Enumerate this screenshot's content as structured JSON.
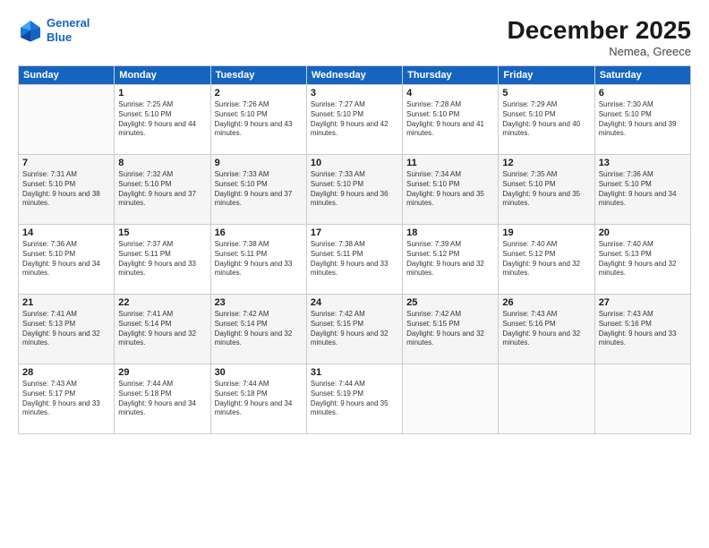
{
  "logo": {
    "line1": "General",
    "line2": "Blue"
  },
  "title": "December 2025",
  "location": "Nemea, Greece",
  "days_header": [
    "Sunday",
    "Monday",
    "Tuesday",
    "Wednesday",
    "Thursday",
    "Friday",
    "Saturday"
  ],
  "weeks": [
    [
      {
        "day": "",
        "sunrise": "",
        "sunset": "",
        "daylight": ""
      },
      {
        "day": "1",
        "sunrise": "Sunrise: 7:25 AM",
        "sunset": "Sunset: 5:10 PM",
        "daylight": "Daylight: 9 hours and 44 minutes."
      },
      {
        "day": "2",
        "sunrise": "Sunrise: 7:26 AM",
        "sunset": "Sunset: 5:10 PM",
        "daylight": "Daylight: 9 hours and 43 minutes."
      },
      {
        "day": "3",
        "sunrise": "Sunrise: 7:27 AM",
        "sunset": "Sunset: 5:10 PM",
        "daylight": "Daylight: 9 hours and 42 minutes."
      },
      {
        "day": "4",
        "sunrise": "Sunrise: 7:28 AM",
        "sunset": "Sunset: 5:10 PM",
        "daylight": "Daylight: 9 hours and 41 minutes."
      },
      {
        "day": "5",
        "sunrise": "Sunrise: 7:29 AM",
        "sunset": "Sunset: 5:10 PM",
        "daylight": "Daylight: 9 hours and 40 minutes."
      },
      {
        "day": "6",
        "sunrise": "Sunrise: 7:30 AM",
        "sunset": "Sunset: 5:10 PM",
        "daylight": "Daylight: 9 hours and 39 minutes."
      }
    ],
    [
      {
        "day": "7",
        "sunrise": "Sunrise: 7:31 AM",
        "sunset": "Sunset: 5:10 PM",
        "daylight": "Daylight: 9 hours and 38 minutes."
      },
      {
        "day": "8",
        "sunrise": "Sunrise: 7:32 AM",
        "sunset": "Sunset: 5:10 PM",
        "daylight": "Daylight: 9 hours and 37 minutes."
      },
      {
        "day": "9",
        "sunrise": "Sunrise: 7:33 AM",
        "sunset": "Sunset: 5:10 PM",
        "daylight": "Daylight: 9 hours and 37 minutes."
      },
      {
        "day": "10",
        "sunrise": "Sunrise: 7:33 AM",
        "sunset": "Sunset: 5:10 PM",
        "daylight": "Daylight: 9 hours and 36 minutes."
      },
      {
        "day": "11",
        "sunrise": "Sunrise: 7:34 AM",
        "sunset": "Sunset: 5:10 PM",
        "daylight": "Daylight: 9 hours and 35 minutes."
      },
      {
        "day": "12",
        "sunrise": "Sunrise: 7:35 AM",
        "sunset": "Sunset: 5:10 PM",
        "daylight": "Daylight: 9 hours and 35 minutes."
      },
      {
        "day": "13",
        "sunrise": "Sunrise: 7:36 AM",
        "sunset": "Sunset: 5:10 PM",
        "daylight": "Daylight: 9 hours and 34 minutes."
      }
    ],
    [
      {
        "day": "14",
        "sunrise": "Sunrise: 7:36 AM",
        "sunset": "Sunset: 5:10 PM",
        "daylight": "Daylight: 9 hours and 34 minutes."
      },
      {
        "day": "15",
        "sunrise": "Sunrise: 7:37 AM",
        "sunset": "Sunset: 5:11 PM",
        "daylight": "Daylight: 9 hours and 33 minutes."
      },
      {
        "day": "16",
        "sunrise": "Sunrise: 7:38 AM",
        "sunset": "Sunset: 5:11 PM",
        "daylight": "Daylight: 9 hours and 33 minutes."
      },
      {
        "day": "17",
        "sunrise": "Sunrise: 7:38 AM",
        "sunset": "Sunset: 5:11 PM",
        "daylight": "Daylight: 9 hours and 33 minutes."
      },
      {
        "day": "18",
        "sunrise": "Sunrise: 7:39 AM",
        "sunset": "Sunset: 5:12 PM",
        "daylight": "Daylight: 9 hours and 32 minutes."
      },
      {
        "day": "19",
        "sunrise": "Sunrise: 7:40 AM",
        "sunset": "Sunset: 5:12 PM",
        "daylight": "Daylight: 9 hours and 32 minutes."
      },
      {
        "day": "20",
        "sunrise": "Sunrise: 7:40 AM",
        "sunset": "Sunset: 5:13 PM",
        "daylight": "Daylight: 9 hours and 32 minutes."
      }
    ],
    [
      {
        "day": "21",
        "sunrise": "Sunrise: 7:41 AM",
        "sunset": "Sunset: 5:13 PM",
        "daylight": "Daylight: 9 hours and 32 minutes."
      },
      {
        "day": "22",
        "sunrise": "Sunrise: 7:41 AM",
        "sunset": "Sunset: 5:14 PM",
        "daylight": "Daylight: 9 hours and 32 minutes."
      },
      {
        "day": "23",
        "sunrise": "Sunrise: 7:42 AM",
        "sunset": "Sunset: 5:14 PM",
        "daylight": "Daylight: 9 hours and 32 minutes."
      },
      {
        "day": "24",
        "sunrise": "Sunrise: 7:42 AM",
        "sunset": "Sunset: 5:15 PM",
        "daylight": "Daylight: 9 hours and 32 minutes."
      },
      {
        "day": "25",
        "sunrise": "Sunrise: 7:42 AM",
        "sunset": "Sunset: 5:15 PM",
        "daylight": "Daylight: 9 hours and 32 minutes."
      },
      {
        "day": "26",
        "sunrise": "Sunrise: 7:43 AM",
        "sunset": "Sunset: 5:16 PM",
        "daylight": "Daylight: 9 hours and 32 minutes."
      },
      {
        "day": "27",
        "sunrise": "Sunrise: 7:43 AM",
        "sunset": "Sunset: 5:16 PM",
        "daylight": "Daylight: 9 hours and 33 minutes."
      }
    ],
    [
      {
        "day": "28",
        "sunrise": "Sunrise: 7:43 AM",
        "sunset": "Sunset: 5:17 PM",
        "daylight": "Daylight: 9 hours and 33 minutes."
      },
      {
        "day": "29",
        "sunrise": "Sunrise: 7:44 AM",
        "sunset": "Sunset: 5:18 PM",
        "daylight": "Daylight: 9 hours and 34 minutes."
      },
      {
        "day": "30",
        "sunrise": "Sunrise: 7:44 AM",
        "sunset": "Sunset: 5:18 PM",
        "daylight": "Daylight: 9 hours and 34 minutes."
      },
      {
        "day": "31",
        "sunrise": "Sunrise: 7:44 AM",
        "sunset": "Sunset: 5:19 PM",
        "daylight": "Daylight: 9 hours and 35 minutes."
      },
      {
        "day": "",
        "sunrise": "",
        "sunset": "",
        "daylight": ""
      },
      {
        "day": "",
        "sunrise": "",
        "sunset": "",
        "daylight": ""
      },
      {
        "day": "",
        "sunrise": "",
        "sunset": "",
        "daylight": ""
      }
    ]
  ]
}
